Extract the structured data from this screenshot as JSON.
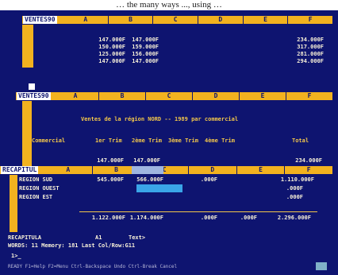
{
  "caption": "… the many ways ..., using …",
  "pane1": {
    "name": "VENTES90",
    "cols": [
      "A",
      "B",
      "C",
      "D",
      "E",
      "F"
    ],
    "rows": [
      [
        "147.000F",
        "147.000F",
        "234.000F"
      ],
      [
        "150.000F",
        "159.000F",
        "317.000F"
      ],
      [
        "125.000F",
        "156.000F",
        "281.000F"
      ],
      [
        "147.000F",
        "147.000F",
        "294.000F"
      ]
    ]
  },
  "pane2": {
    "name": "VENTES90",
    "cols": [
      "A",
      "B",
      "C",
      "D",
      "E",
      "F"
    ],
    "title": "Ventes de la région NORD -- 1989 par commercial",
    "headers": [
      "Commercial",
      "1er Trim",
      "2ème Trim",
      "3ème Trim",
      "4ème Trim",
      "Total"
    ],
    "row": [
      "147.000F",
      "147.000F",
      "234.000F"
    ]
  },
  "pane3": {
    "name": "RECAPITUL",
    "cols": [
      "A",
      "B",
      "C",
      "D",
      "E",
      "F"
    ],
    "rows": [
      {
        "label": "REGION SUD",
        "b": "545.000F",
        "c": "566.000F",
        "d": ".000F",
        "f": "1.110.000F"
      },
      {
        "label": "REGION OUEST",
        "f": ".000F"
      },
      {
        "label": "REGION EST",
        "f": ".000F"
      }
    ],
    "totals": [
      "1.122.000F",
      "1.174.000F",
      ".000F",
      ".000F",
      "2.296.000F"
    ]
  },
  "status": {
    "line1_name": "RECAPITULA",
    "line1_a1": "A1",
    "line1_text": "Text>",
    "line2": "WORDS: 11  Memory:  181  Last Col/Row:G11",
    "line3": "1>_",
    "fkeys": "READY  F1=Help  F2=Menu  Ctrl-Backspace Undo  Ctrl-Break Cancel"
  },
  "colors": {
    "screen": "#0e1470",
    "header": "#f2b21f",
    "text": "#f2c64a",
    "value": "#f7f0d8",
    "selection": "#3aa5e8"
  }
}
